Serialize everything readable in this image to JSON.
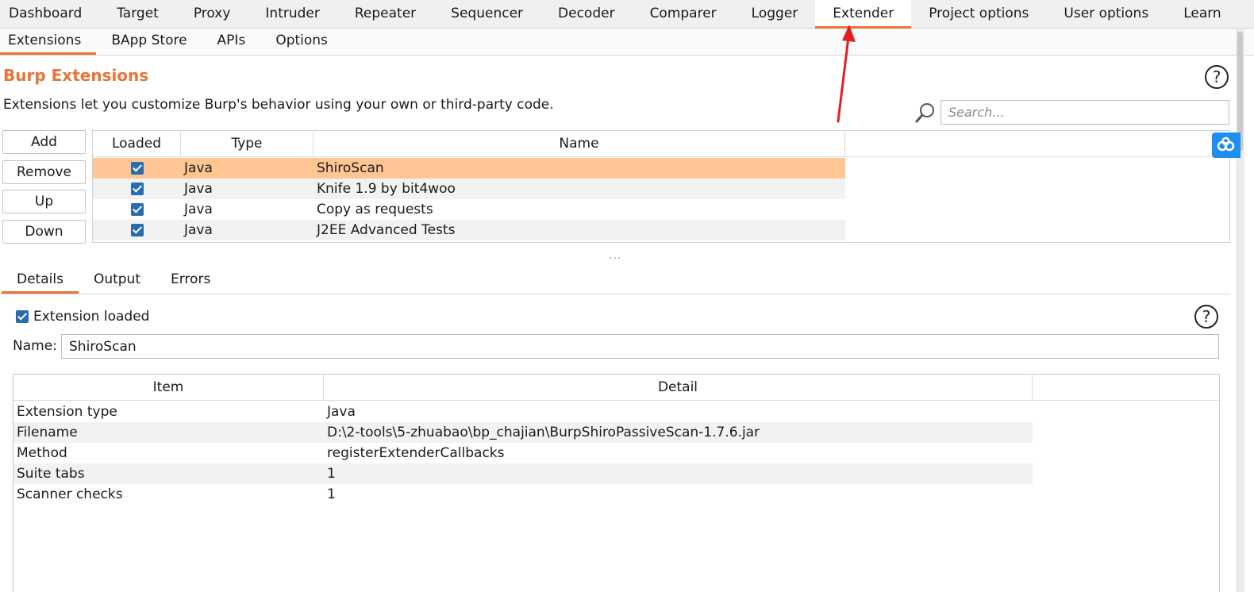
{
  "top_tabs": [
    "Dashboard",
    "Target",
    "Proxy",
    "Intruder",
    "Repeater",
    "Sequencer",
    "Decoder",
    "Comparer",
    "Logger",
    "Extender",
    "Project options",
    "User options",
    "Learn"
  ],
  "top_tabs_active": "Extender",
  "sub_tabs": [
    "Extensions",
    "BApp Store",
    "APIs",
    "Options"
  ],
  "sub_tabs_active": "Extensions",
  "section": {
    "title": "Burp Extensions",
    "description": "Extensions let you customize Burp's behavior using your own or third-party code.",
    "help_symbol": "?"
  },
  "search": {
    "placeholder": "Search..."
  },
  "buttons": {
    "add": "Add",
    "remove": "Remove",
    "up": "Up",
    "down": "Down"
  },
  "extensions_table": {
    "headers": {
      "loaded": "Loaded",
      "type": "Type",
      "name": "Name"
    },
    "rows": [
      {
        "loaded": true,
        "type": "Java",
        "name": "ShiroScan"
      },
      {
        "loaded": true,
        "type": "Java",
        "name": "Knife 1.9 by bit4woo"
      },
      {
        "loaded": true,
        "type": "Java",
        "name": "Copy as requests"
      },
      {
        "loaded": true,
        "type": "Java",
        "name": "J2EE Advanced Tests"
      }
    ],
    "selected_row": "ShiroScan"
  },
  "splitter": "...",
  "detail_tabs": [
    "Details",
    "Output",
    "Errors"
  ],
  "detail_tabs_active": "Details",
  "details": {
    "extension_loaded_label": "Extension loaded",
    "extension_loaded": true,
    "name_label": "Name:",
    "name_value": "ShiroScan",
    "help_symbol": "?",
    "table_headers": {
      "item": "Item",
      "detail": "Detail"
    },
    "rows": [
      {
        "item": "Extension type",
        "detail": "Java"
      },
      {
        "item": "Filename",
        "detail": "D:\\2-tools\\5-zhuabao\\bp_chajian\\BurpShiroPassiveScan-1.7.6.jar"
      },
      {
        "item": "Method",
        "detail": "registerExtenderCallbacks"
      },
      {
        "item": "Suite tabs",
        "detail": "1"
      },
      {
        "item": "Scanner checks",
        "detail": "1"
      }
    ]
  },
  "colors": {
    "accent": "#e8743b",
    "selected_row": "#ffc593",
    "checkbox": "#2b6cb0",
    "annotation_arrow": "#e02020",
    "floating_button": "#1e8ff0"
  }
}
